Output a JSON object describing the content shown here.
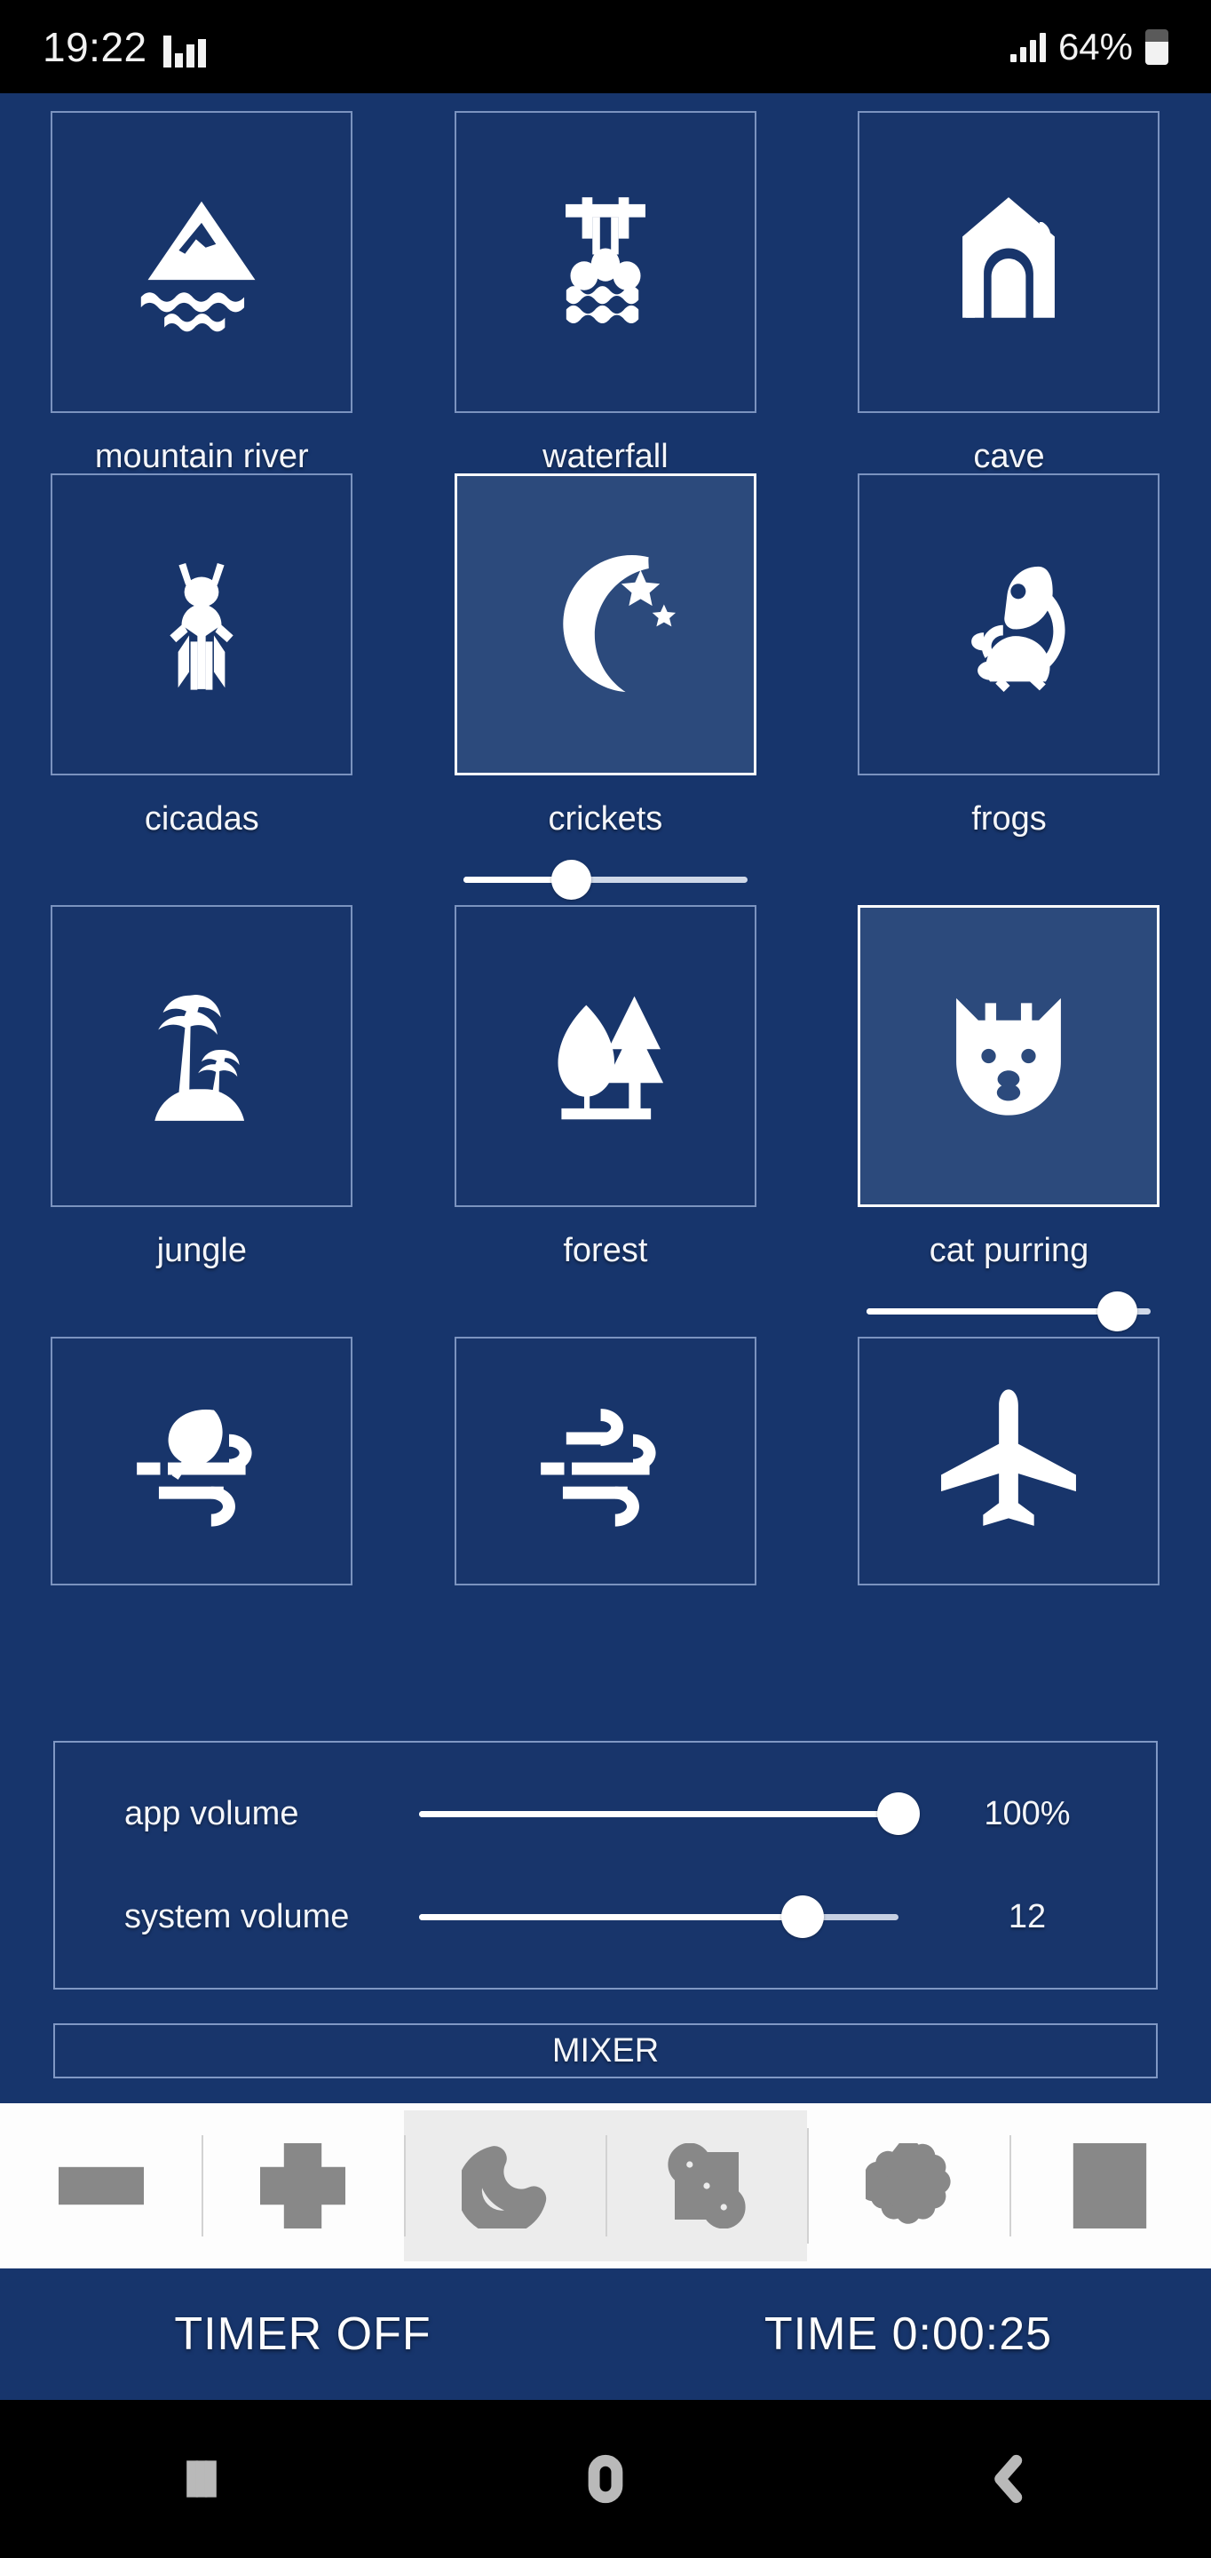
{
  "status_bar": {
    "clock": "19:22",
    "battery_percent": "64%",
    "battery_level": 64,
    "music_icon": "equalizer-icon",
    "signal_icon": "signal-bars-icon",
    "battery_icon": "battery-icon"
  },
  "theme": {
    "background": "#17356c",
    "tile_bg": "#18356b",
    "tile_selected_bg": "#2c4a7c",
    "tile_border": "#7b93bf",
    "tile_selected_border": "#ffffff",
    "text": "#f4f6fa",
    "toolbar_bg": "#fdfdfd",
    "toolbar_icon": "#888888",
    "toolbar_active_bg": "#ececec"
  },
  "sounds": [
    {
      "label": "mountain river",
      "icon": "mountain-river-icon",
      "selected": false,
      "volume": null
    },
    {
      "label": "waterfall",
      "icon": "waterfall-icon",
      "selected": false,
      "volume": null
    },
    {
      "label": "cave",
      "icon": "cave-icon",
      "selected": false,
      "volume": null
    },
    {
      "label": "cicadas",
      "icon": "cicada-icon",
      "selected": false,
      "volume": null
    },
    {
      "label": "crickets",
      "icon": "moon-stars-icon",
      "selected": true,
      "volume": 38
    },
    {
      "label": "frogs",
      "icon": "frog-icon",
      "selected": false,
      "volume": null
    },
    {
      "label": "jungle",
      "icon": "palm-island-icon",
      "selected": false,
      "volume": null
    },
    {
      "label": "forest",
      "icon": "forest-trees-icon",
      "selected": false,
      "volume": null
    },
    {
      "label": "cat purring",
      "icon": "cat-face-icon",
      "selected": true,
      "volume": 88
    },
    {
      "label": "",
      "icon": "wind-leaf-icon",
      "selected": false,
      "volume": null
    },
    {
      "label": "",
      "icon": "wind-icon",
      "selected": false,
      "volume": null
    },
    {
      "label": "",
      "icon": "airplane-icon",
      "selected": false,
      "volume": null
    }
  ],
  "volume_panel": {
    "app": {
      "label": "app volume",
      "value_text": "100%",
      "percent": 100
    },
    "system": {
      "label": "system volume",
      "value_text": "12",
      "percent": 80
    }
  },
  "mixer_button": {
    "label": "MIXER"
  },
  "toolbar": [
    {
      "name": "volume-down-button",
      "icon": "minus-icon",
      "active": false
    },
    {
      "name": "volume-up-button",
      "icon": "plus-icon",
      "active": false
    },
    {
      "name": "night-mode-button",
      "icon": "moon-icon",
      "active": true
    },
    {
      "name": "mixer-button",
      "icon": "sliders-icon",
      "active": true
    },
    {
      "name": "settings-button",
      "icon": "gear-icon",
      "active": false
    },
    {
      "name": "pause-button",
      "icon": "pause-icon",
      "active": false
    }
  ],
  "timer_bar": {
    "timer_label": "TIMER  OFF",
    "time_label": "TIME  0:00:25"
  },
  "nav_bar": {
    "recents": "recents-icon",
    "home": "home-icon",
    "back": "back-icon"
  }
}
